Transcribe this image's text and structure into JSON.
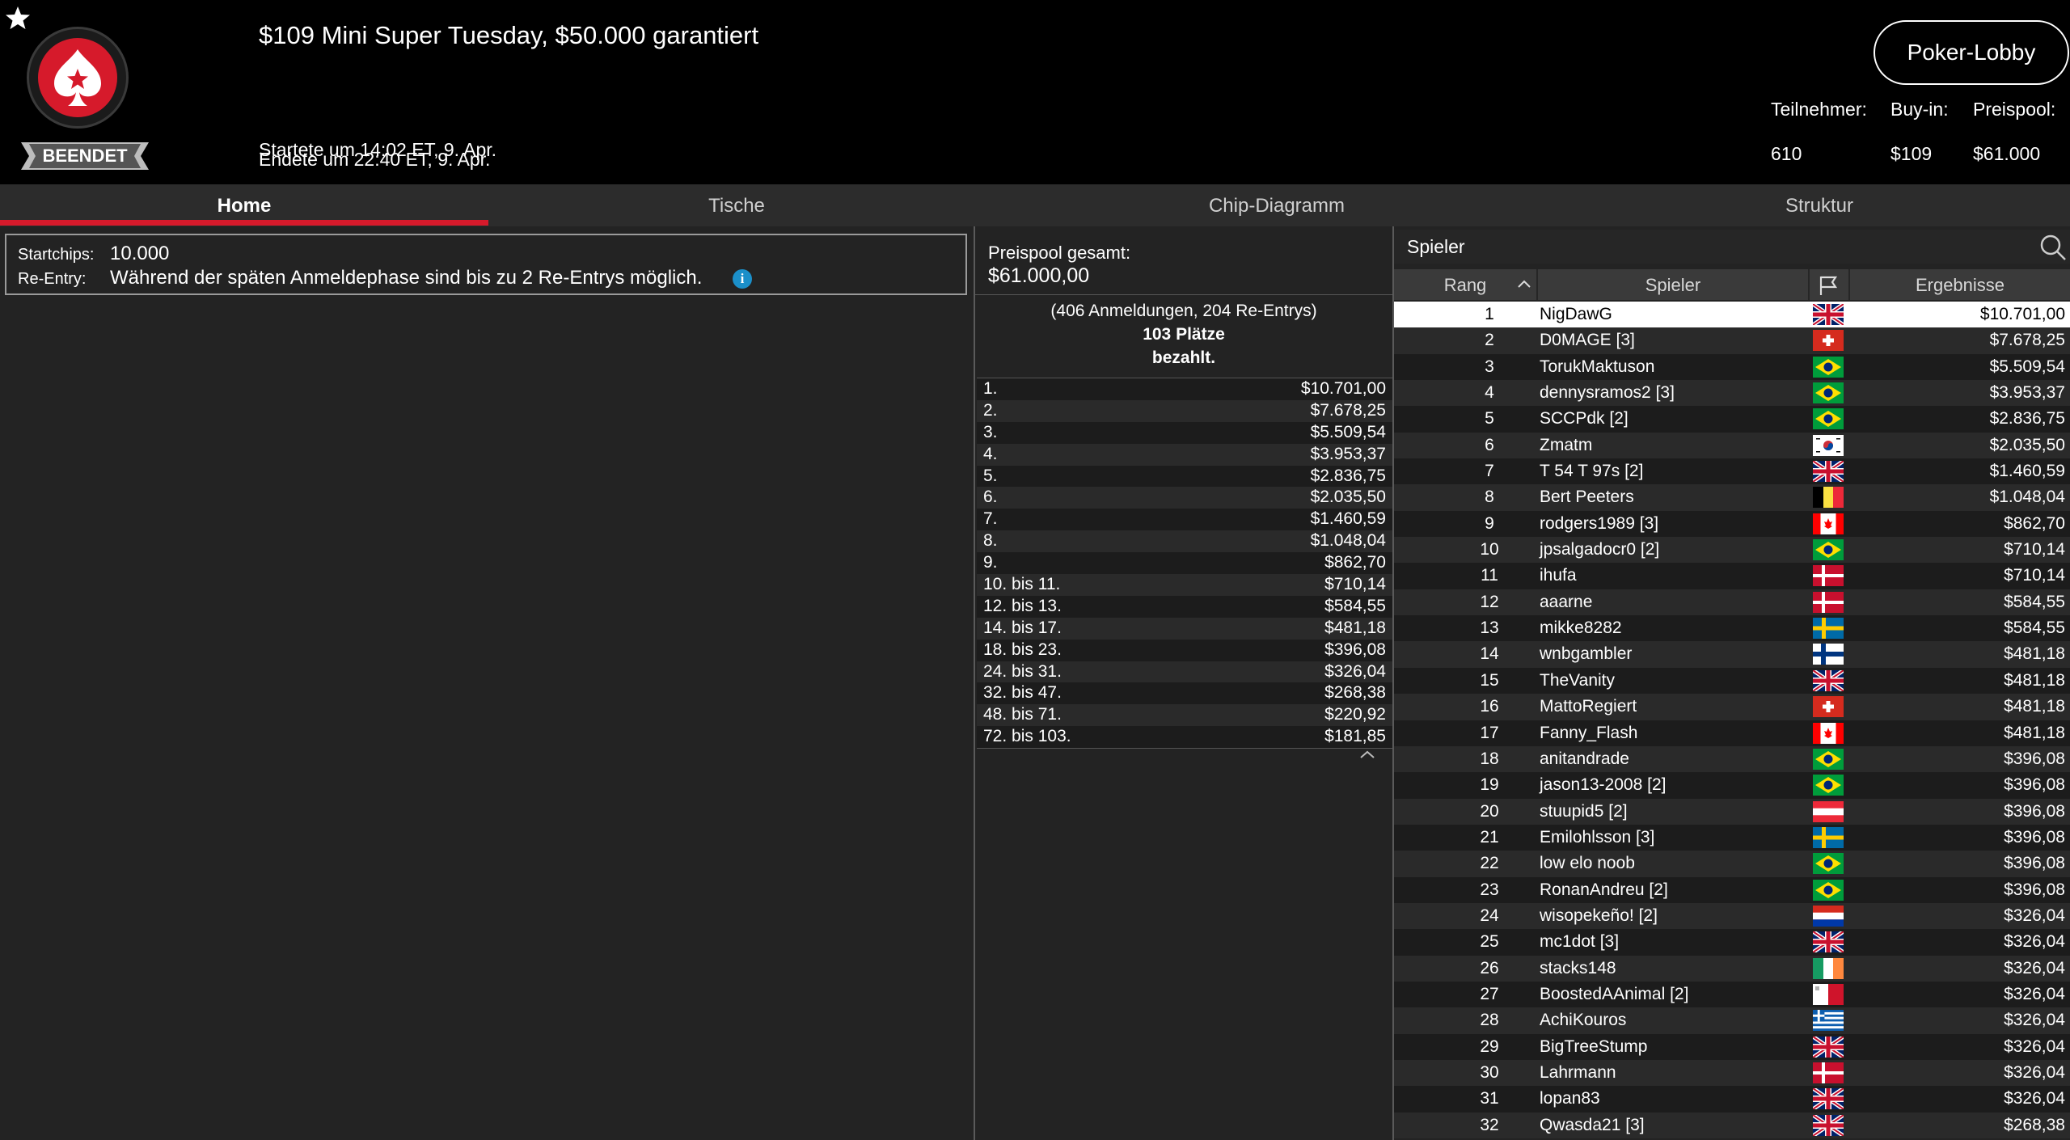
{
  "header": {
    "title": "$109 Mini Super Tuesday, $50.000 garantiert",
    "status": "BEENDET",
    "started": "Startete um 14:02 ET, 9. Apr.",
    "ended": "Endete um 22:40 ET, 9. Apr.",
    "lobby_button": "Poker-Lobby",
    "stats": {
      "participants_label": "Teilnehmer:",
      "participants_value": "610",
      "buyin_label": "Buy-in:",
      "buyin_value": "$109",
      "prizepool_label": "Preispool:",
      "prizepool_value": "$61.000"
    }
  },
  "tabs": [
    {
      "label": "Home",
      "active": true
    },
    {
      "label": "Tische",
      "active": false
    },
    {
      "label": "Chip-Diagramm",
      "active": false
    },
    {
      "label": "Struktur",
      "active": false
    }
  ],
  "info": {
    "startchips_label": "Startchips:",
    "startchips_value": "10.000",
    "reentry_label": "Re-Entry:",
    "reentry_value": "Während der späten Anmeldephase sind bis zu 2 Re-Entrys möglich.",
    "info_glyph": "i"
  },
  "prizes": {
    "total_label": "Preispool gesamt:",
    "total_value": "$61.000,00",
    "entries": "(406 Anmeldungen, 204 Re-Entrys)",
    "places": "103 Plätze",
    "paid": "bezahlt.",
    "payouts": [
      {
        "place": "1.",
        "amount": "$10.701,00"
      },
      {
        "place": "2.",
        "amount": "$7.678,25"
      },
      {
        "place": "3.",
        "amount": "$5.509,54"
      },
      {
        "place": "4.",
        "amount": "$3.953,37"
      },
      {
        "place": "5.",
        "amount": "$2.836,75"
      },
      {
        "place": "6.",
        "amount": "$2.035,50"
      },
      {
        "place": "7.",
        "amount": "$1.460,59"
      },
      {
        "place": "8.",
        "amount": "$1.048,04"
      },
      {
        "place": "9.",
        "amount": "$862,70"
      },
      {
        "place": "10. bis 11.",
        "amount": "$710,14"
      },
      {
        "place": "12. bis 13.",
        "amount": "$584,55"
      },
      {
        "place": "14. bis 17.",
        "amount": "$481,18"
      },
      {
        "place": "18. bis 23.",
        "amount": "$396,08"
      },
      {
        "place": "24. bis 31.",
        "amount": "$326,04"
      },
      {
        "place": "32. bis 47.",
        "amount": "$268,38"
      },
      {
        "place": "48. bis 71.",
        "amount": "$220,92"
      },
      {
        "place": "72. bis 103.",
        "amount": "$181,85"
      }
    ]
  },
  "players": {
    "title": "Spieler",
    "columns": {
      "rank": "Rang",
      "player": "Spieler",
      "result": "Ergebnisse"
    },
    "rows": [
      {
        "rank": "1",
        "name": "NigDawG",
        "flag": "uk",
        "amount": "$10.701,00",
        "selected": true
      },
      {
        "rank": "2",
        "name": "D0MAGE [3]",
        "flag": "ch",
        "amount": "$7.678,25"
      },
      {
        "rank": "3",
        "name": "TorukMaktuson",
        "flag": "br",
        "amount": "$5.509,54"
      },
      {
        "rank": "4",
        "name": "dennysramos2 [3]",
        "flag": "br",
        "amount": "$3.953,37"
      },
      {
        "rank": "5",
        "name": "SCCPdk [2]",
        "flag": "br",
        "amount": "$2.836,75"
      },
      {
        "rank": "6",
        "name": "Zmatm",
        "flag": "kr",
        "amount": "$2.035,50"
      },
      {
        "rank": "7",
        "name": "T 54 T 97s [2]",
        "flag": "uk",
        "amount": "$1.460,59"
      },
      {
        "rank": "8",
        "name": "Bert Peeters",
        "flag": "be",
        "amount": "$1.048,04"
      },
      {
        "rank": "9",
        "name": "rodgers1989 [3]",
        "flag": "ca",
        "amount": "$862,70"
      },
      {
        "rank": "10",
        "name": "jpsalgadocr0 [2]",
        "flag": "br",
        "amount": "$710,14"
      },
      {
        "rank": "11",
        "name": "ihufa",
        "flag": "dk",
        "amount": "$710,14"
      },
      {
        "rank": "12",
        "name": "aaarne",
        "flag": "dk",
        "amount": "$584,55"
      },
      {
        "rank": "13",
        "name": "mikke8282",
        "flag": "se",
        "amount": "$584,55"
      },
      {
        "rank": "14",
        "name": "wnbgambler",
        "flag": "fi",
        "amount": "$481,18"
      },
      {
        "rank": "15",
        "name": "TheVanity",
        "flag": "uk",
        "amount": "$481,18"
      },
      {
        "rank": "16",
        "name": "MattoRegiert",
        "flag": "ch",
        "amount": "$481,18"
      },
      {
        "rank": "17",
        "name": "Fanny_Flash",
        "flag": "ca",
        "amount": "$481,18"
      },
      {
        "rank": "18",
        "name": "anitandrade",
        "flag": "br",
        "amount": "$396,08"
      },
      {
        "rank": "19",
        "name": "jason13-2008 [2]",
        "flag": "br",
        "amount": "$396,08"
      },
      {
        "rank": "20",
        "name": "stuupid5 [2]",
        "flag": "at",
        "amount": "$396,08"
      },
      {
        "rank": "21",
        "name": "Emilohlsson [3]",
        "flag": "se",
        "amount": "$396,08"
      },
      {
        "rank": "22",
        "name": "low elo noob",
        "flag": "br",
        "amount": "$396,08"
      },
      {
        "rank": "23",
        "name": "RonanAndreu [2]",
        "flag": "br",
        "amount": "$396,08"
      },
      {
        "rank": "24",
        "name": "wisopekeño! [2]",
        "flag": "py",
        "amount": "$326,04"
      },
      {
        "rank": "25",
        "name": "mc1dot [3]",
        "flag": "uk",
        "amount": "$326,04"
      },
      {
        "rank": "26",
        "name": "stacks148",
        "flag": "ie",
        "amount": "$326,04"
      },
      {
        "rank": "27",
        "name": "BoostedAAnimal [2]",
        "flag": "mt",
        "amount": "$326,04"
      },
      {
        "rank": "28",
        "name": "AchiKouros",
        "flag": "gr",
        "amount": "$326,04"
      },
      {
        "rank": "29",
        "name": "BigTreeStump",
        "flag": "uk",
        "amount": "$326,04"
      },
      {
        "rank": "30",
        "name": "Lahrmann",
        "flag": "dk",
        "amount": "$326,04"
      },
      {
        "rank": "31",
        "name": "lopan83",
        "flag": "uk",
        "amount": "$326,04"
      },
      {
        "rank": "32",
        "name": "Qwasda21 [3]",
        "flag": "uk",
        "amount": "$268,38"
      }
    ]
  },
  "colors": {
    "accent": "#d61a2b",
    "info_blue": "#1b8fc9",
    "header_bg": "#000000",
    "panel_bg": "#232323"
  }
}
